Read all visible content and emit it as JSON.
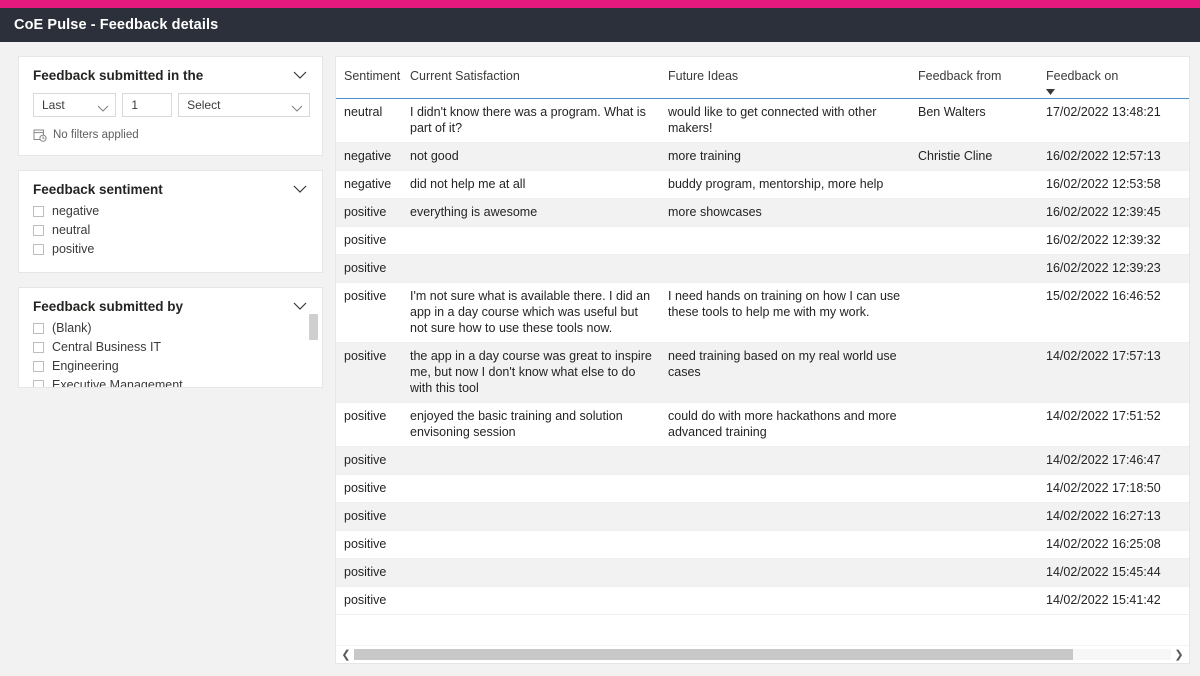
{
  "header": {
    "title": "CoE Pulse - Feedback details",
    "accent_color": "#e5197e",
    "bar_color": "#2b303a"
  },
  "filters": {
    "date_card": {
      "title": "Feedback submitted in the",
      "chevron_icon": "chevron-down-icon",
      "relation_value": "Last",
      "amount_value": "1",
      "unit_value": "Select",
      "status_text": "No filters applied",
      "status_icon": "calendar-clock-icon"
    },
    "sentiment_card": {
      "title": "Feedback sentiment",
      "chevron_icon": "chevron-down-icon",
      "items": [
        {
          "label": "negative",
          "checked": false
        },
        {
          "label": "neutral",
          "checked": false
        },
        {
          "label": "positive",
          "checked": false
        }
      ]
    },
    "submitted_by_card": {
      "title": "Feedback submitted by",
      "chevron_icon": "chevron-down-icon",
      "items": [
        {
          "label": "(Blank)",
          "checked": false
        },
        {
          "label": "Central Business IT",
          "checked": false
        },
        {
          "label": "Engineering",
          "checked": false
        },
        {
          "label": "Executive Management",
          "checked": false
        }
      ]
    }
  },
  "table": {
    "columns": [
      "Sentiment",
      "Current Satisfaction",
      "Future Ideas",
      "Feedback from",
      "Feedback on"
    ],
    "sorted_column": "Feedback on",
    "sort_direction": "descending",
    "sort_icon": "caret-down-icon",
    "header_underline_color": "#4a8fc7",
    "rows": [
      {
        "sentiment": "neutral",
        "current_satisfaction": "I didn't know there was a program. What is part of it?",
        "future_ideas": "would like to get connected with other makers!",
        "feedback_from": "Ben Walters",
        "feedback_on": "17/02/2022 13:48:21"
      },
      {
        "sentiment": "negative",
        "current_satisfaction": "not good",
        "future_ideas": "more training",
        "feedback_from": "Christie Cline",
        "feedback_on": "16/02/2022 12:57:13"
      },
      {
        "sentiment": "negative",
        "current_satisfaction": "did not help me at all",
        "future_ideas": "buddy program, mentorship, more help",
        "feedback_from": "",
        "feedback_on": "16/02/2022 12:53:58"
      },
      {
        "sentiment": "positive",
        "current_satisfaction": "everything is awesome",
        "future_ideas": "more showcases",
        "feedback_from": "",
        "feedback_on": "16/02/2022 12:39:45"
      },
      {
        "sentiment": "positive",
        "current_satisfaction": "",
        "future_ideas": "",
        "feedback_from": "",
        "feedback_on": "16/02/2022 12:39:32"
      },
      {
        "sentiment": "positive",
        "current_satisfaction": "",
        "future_ideas": "",
        "feedback_from": "",
        "feedback_on": "16/02/2022 12:39:23"
      },
      {
        "sentiment": "positive",
        "current_satisfaction": "I'm not sure what is available there. I did an app in a day course which was useful but not sure how to use these tools now.",
        "future_ideas": "I need hands on training on how I can use these tools to help me with my work.",
        "feedback_from": "",
        "feedback_on": "15/02/2022 16:46:52"
      },
      {
        "sentiment": "positive",
        "current_satisfaction": "the app in a day course was great to inspire me, but now I don't know what else to do with this tool",
        "future_ideas": "need training based on my real world use cases",
        "feedback_from": "",
        "feedback_on": "14/02/2022 17:57:13"
      },
      {
        "sentiment": "positive",
        "current_satisfaction": "enjoyed the basic training and solution envisoning session",
        "future_ideas": "could do with more hackathons and more advanced training",
        "feedback_from": "",
        "feedback_on": "14/02/2022 17:51:52"
      },
      {
        "sentiment": "positive",
        "current_satisfaction": "",
        "future_ideas": "",
        "feedback_from": "",
        "feedback_on": "14/02/2022 17:46:47"
      },
      {
        "sentiment": "positive",
        "current_satisfaction": "",
        "future_ideas": "",
        "feedback_from": "",
        "feedback_on": "14/02/2022 17:18:50"
      },
      {
        "sentiment": "positive",
        "current_satisfaction": "",
        "future_ideas": "",
        "feedback_from": "",
        "feedback_on": "14/02/2022 16:27:13"
      },
      {
        "sentiment": "positive",
        "current_satisfaction": "",
        "future_ideas": "",
        "feedback_from": "",
        "feedback_on": "14/02/2022 16:25:08"
      },
      {
        "sentiment": "positive",
        "current_satisfaction": "",
        "future_ideas": "",
        "feedback_from": "",
        "feedback_on": "14/02/2022 15:45:44"
      },
      {
        "sentiment": "positive",
        "current_satisfaction": "",
        "future_ideas": "",
        "feedback_from": "",
        "feedback_on": "14/02/2022 15:41:42"
      }
    ],
    "hscrollbar": {
      "left_arrow_icon": "chevron-left-icon",
      "right_arrow_icon": "chevron-right-icon",
      "thumb_fraction": 0.88
    }
  }
}
